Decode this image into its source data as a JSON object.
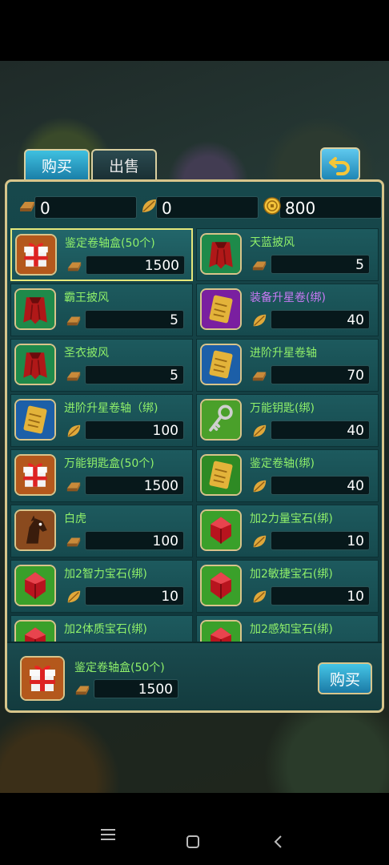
{
  "tabs": [
    {
      "label": "购买",
      "active": true
    },
    {
      "label": "出售",
      "active": false
    }
  ],
  "currencies": [
    {
      "icon": "iron-ingot-icon",
      "value": "0"
    },
    {
      "icon": "leaf-token-icon",
      "value": "0"
    },
    {
      "icon": "gold-coin-icon",
      "value": "800"
    }
  ],
  "items": [
    {
      "name": "鉴定卷轴盒(50个)",
      "icon": "gift-box-icon",
      "currency": "iron-ingot-icon",
      "price": "1500",
      "selected": true
    },
    {
      "name": "天蓝披风",
      "icon": "red-cape-icon",
      "currency": "iron-ingot-icon",
      "price": "5"
    },
    {
      "name": "霸王披风",
      "icon": "red-cape-icon",
      "currency": "iron-ingot-icon",
      "price": "5"
    },
    {
      "name": "装备升星卷(绑)",
      "icon": "scroll-purple-icon",
      "currency": "leaf-token-icon",
      "price": "40",
      "color": "purple"
    },
    {
      "name": "圣衣披风",
      "icon": "red-cape-icon",
      "currency": "iron-ingot-icon",
      "price": "5"
    },
    {
      "name": "进阶升星卷轴",
      "icon": "scroll-blue-icon",
      "currency": "iron-ingot-icon",
      "price": "70"
    },
    {
      "name": "进阶升星卷轴（绑)",
      "icon": "scroll-blue-icon",
      "currency": "leaf-token-icon",
      "price": "100"
    },
    {
      "name": "万能钥匙(绑)",
      "icon": "key-icon",
      "currency": "leaf-token-icon",
      "price": "40"
    },
    {
      "name": "万能钥匙盒(50个)",
      "icon": "gift-box-icon",
      "currency": "iron-ingot-icon",
      "price": "1500"
    },
    {
      "name": "鉴定卷轴(绑)",
      "icon": "scroll-green-icon",
      "currency": "leaf-token-icon",
      "price": "40"
    },
    {
      "name": "白虎",
      "icon": "horse-icon",
      "currency": "iron-ingot-icon",
      "price": "100"
    },
    {
      "name": "加2力量宝石(绑)",
      "icon": "red-gem-icon",
      "currency": "leaf-token-icon",
      "price": "10"
    },
    {
      "name": "加2智力宝石(绑)",
      "icon": "red-gem-icon",
      "currency": "leaf-token-icon",
      "price": "10"
    },
    {
      "name": "加2敏捷宝石(绑)",
      "icon": "red-gem-icon",
      "currency": "leaf-token-icon",
      "price": "10"
    },
    {
      "name": "加2体质宝石(绑)",
      "icon": "red-gem-icon",
      "currency": "leaf-token-icon",
      "price": ""
    },
    {
      "name": "加2感知宝石(绑)",
      "icon": "red-gem-icon",
      "currency": "leaf-token-icon",
      "price": ""
    }
  ],
  "selected": {
    "name": "鉴定卷轴盒(50个)",
    "icon": "gift-box-icon",
    "currency": "iron-ingot-icon",
    "price": "1500"
  },
  "buy_button": "购买",
  "nav": {
    "menu": "menu-icon",
    "home": "home-icon",
    "back": "back-icon"
  }
}
